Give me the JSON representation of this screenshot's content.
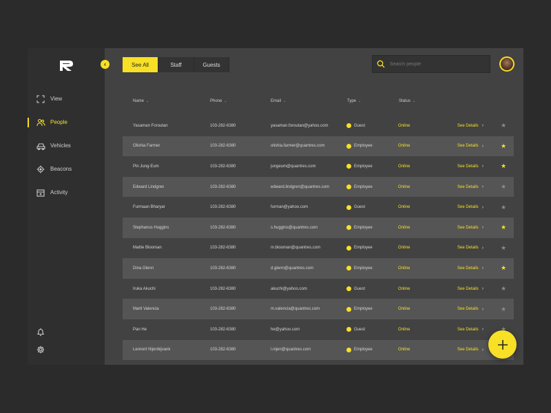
{
  "sidebar": {
    "items": [
      {
        "label": "View",
        "icon": "expand-icon",
        "active": false
      },
      {
        "label": "People",
        "icon": "people-icon",
        "active": true
      },
      {
        "label": "Vehicles",
        "icon": "car-icon",
        "active": false
      },
      {
        "label": "Beacons",
        "icon": "beacon-icon",
        "active": false
      },
      {
        "label": "Activity",
        "icon": "calendar-icon",
        "active": false
      }
    ],
    "collapse_glyph": "‹"
  },
  "tabs": [
    {
      "label": "See All",
      "active": true
    },
    {
      "label": "Staff",
      "active": false
    },
    {
      "label": "Guests",
      "active": false
    }
  ],
  "search": {
    "placeholder": "Search people"
  },
  "table": {
    "columns": [
      "Name",
      "Phone",
      "Email",
      "Type",
      "Status"
    ],
    "sort_glyph": "⌄",
    "details_label": "See Details",
    "details_arrow": "›",
    "star_glyph": "★",
    "rows": [
      {
        "name": "Yasaman Foroutan",
        "phone": "103-282-6380",
        "email": "yasaman.foroutan@yahoo.com",
        "type": "Guest",
        "status": "Online",
        "starred": false
      },
      {
        "name": "Olishia Farmer",
        "phone": "103-282-6380",
        "email": "olishia.farmer@quantres.com",
        "type": "Employee",
        "status": "Online",
        "starred": true
      },
      {
        "name": "Pin Jung-Eum",
        "phone": "103-282-6380",
        "email": "jungeum@quantres.com",
        "type": "Employee",
        "status": "Online",
        "starred": true
      },
      {
        "name": "Edward Lindgren",
        "phone": "103-282-6380",
        "email": "edward.lindgren@quantres.com",
        "type": "Employee",
        "status": "Online",
        "starred": false
      },
      {
        "name": "Furmaan Bharyar",
        "phone": "103-282-6380",
        "email": "furman@yahoo.com",
        "type": "Guest",
        "status": "Online",
        "starred": false
      },
      {
        "name": "Stephanus Huggins",
        "phone": "103-282-6380",
        "email": "s.huggins@quantres.com",
        "type": "Employee",
        "status": "Online",
        "starred": true
      },
      {
        "name": "Mattie Blooman",
        "phone": "103-282-6380",
        "email": "m.blooman@quantres.com",
        "type": "Employee",
        "status": "Online",
        "starred": false
      },
      {
        "name": "Dina Glenn",
        "phone": "103-282-6380",
        "email": "d.glenn@quantres.com",
        "type": "Employee",
        "status": "Online",
        "starred": true
      },
      {
        "name": "Iruka Akuchi",
        "phone": "103-282-6380",
        "email": "akuchi@yahoo.com",
        "type": "Guest",
        "status": "Online",
        "starred": false
      },
      {
        "name": "Marti Valencia",
        "phone": "103-282-6380",
        "email": "m.valencia@quantres.com",
        "type": "Employee",
        "status": "Online",
        "starred": false
      },
      {
        "name": "Pan He",
        "phone": "103-282-6380",
        "email": "he@yahoo.com",
        "type": "Guest",
        "status": "Online",
        "starred": false
      },
      {
        "name": "Lennert Nijenbijvank",
        "phone": "103-282-6380",
        "email": "l.nijen@quantres.com",
        "type": "Employee",
        "status": "Online",
        "starred": false
      }
    ]
  },
  "colors": {
    "accent": "#f7e025",
    "background": "#2b2b2b",
    "panel": "#424242",
    "sidebar": "#2f2f2f",
    "row_alt": "#555555"
  }
}
